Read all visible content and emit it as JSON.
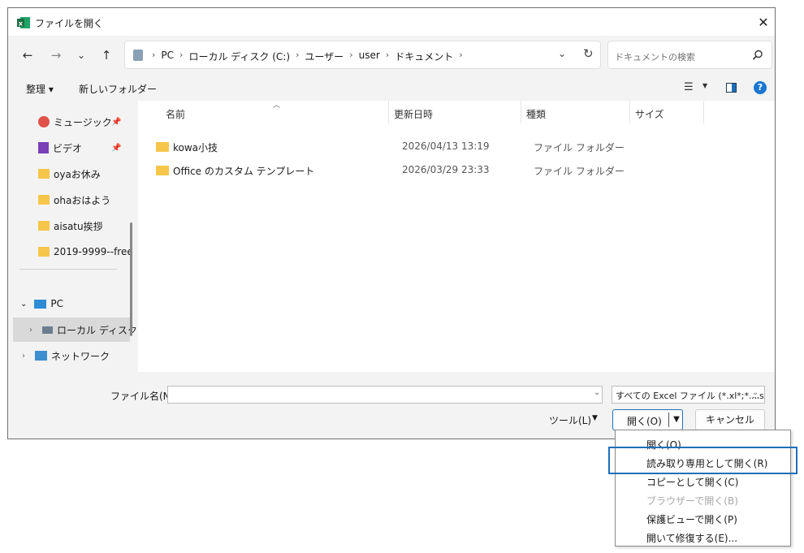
{
  "window": {
    "title": "ファイルを開く",
    "close_label": "✕"
  },
  "nav": {
    "back": "←",
    "forward": "→",
    "recent": "⌄",
    "up": "↑",
    "breadcrumbs": [
      "PC",
      "ローカル ディスク (C:)",
      "ユーザー",
      "user",
      "ドキュメント"
    ],
    "search_placeholder": "ドキュメントの検索"
  },
  "commands": {
    "organize": "整理 ▾",
    "new_folder": "新しいフォルダー"
  },
  "sidebar": {
    "items": [
      {
        "label": "ミュージック",
        "pinned": true
      },
      {
        "label": "ビデオ",
        "pinned": true
      },
      {
        "label": "oyaお休み"
      },
      {
        "label": "ohaおはよう"
      },
      {
        "label": "aisatu挨拶"
      },
      {
        "label": "2019-9999--free"
      },
      {
        "label": "PC"
      },
      {
        "label": "ローカル ディスク"
      },
      {
        "label": "ネットワーク"
      }
    ]
  },
  "columns": {
    "name": "名前",
    "date": "更新日時",
    "type": "種類",
    "size": "サイズ"
  },
  "files": [
    {
      "name": "kowa小技",
      "date": "2026/04/13 13:19",
      "type": "ファイル フォルダー"
    },
    {
      "name": "Office のカスタム テンプレート",
      "date": "2026/03/29 23:33",
      "type": "ファイル フォルダー"
    }
  ],
  "bottom": {
    "filename_label": "ファイル名(N):",
    "filename_value": "",
    "filetype": "すべての Excel ファイル (*.xl*;*.xlsx;",
    "tools": "ツール(L)",
    "open": "開く(O)",
    "cancel": "キャンセル"
  },
  "open_menu": {
    "items": [
      {
        "label": "開く(O)",
        "enabled": true
      },
      {
        "label": "読み取り専用として開く(R)",
        "enabled": true,
        "highlighted": true
      },
      {
        "label": "コピーとして開く(C)",
        "enabled": true
      },
      {
        "label": "ブラウザーで開く(B)",
        "enabled": false
      },
      {
        "label": "保護ビューで開く(P)",
        "enabled": true
      },
      {
        "label": "開いて修復する(E)...",
        "enabled": true
      }
    ]
  },
  "colors": {
    "accent": "#1f6fb8",
    "folder": "#f6c64a",
    "excel_green": "#1d6f42"
  }
}
